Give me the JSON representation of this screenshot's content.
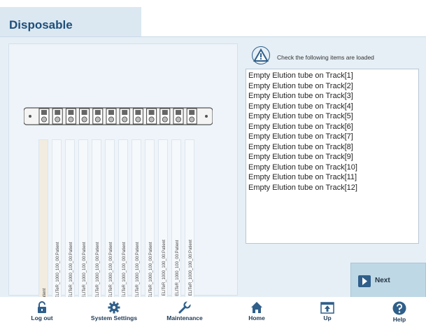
{
  "header": {
    "title": "Disposable",
    "top_right_text": ""
  },
  "instruction": {
    "text": "Check the following items are loaded"
  },
  "items": [
    "Empty Elution tube on Track[1]",
    "Empty Elution tube on Track[2]",
    "Empty Elution tube on Track[3]",
    "Empty Elution tube on Track[4]",
    "Empty Elution tube on Track[5]",
    "Empty Elution tube on Track[6]",
    "Empty Elution tube on Track[7]",
    "Empty Elution tube on Track[8]",
    "Empty Elution tube on Track[9]",
    "Empty Elution tube on Track[10]",
    "Empty Elution tube on Track[11]",
    "Empty Elution tube on Track[12]"
  ],
  "track_labels": [
    "EI 00_00:Patient",
    "EG 2:CMV ELITeR_1000_100_00:Patient",
    "EG 3:CMV ELITeR_1000_100_00:Patient",
    "EG 4:CMV ELITeR_1000_100_00:Patient",
    "EG 5:CMV ELITeR_1000_100_00:Patient",
    "EG 6:CMV ELITeR_1000_100_00:Patient",
    "EG 7:CMV ELITeR_1000_100_00:Patient",
    "EG 8:CMV ELITeR_1000_100_00:Patient",
    "EG 9:CMV ELITeR_1000_100_00:Patient",
    "EG 10:CMV ELITeR_1000_100_00:Patient",
    "EG 11:CMV ELITeR_1000_100_00:Patient",
    "EG 12:CMV ELITeR_1000_100_00:Patient"
  ],
  "next_button": {
    "label": "Next"
  },
  "footer": {
    "logout": "Log out",
    "system_settings": "System Settings",
    "maintenance": "Maintenance",
    "home": "Home",
    "up": "Up",
    "help": "Help"
  },
  "colors": {
    "accent": "#1f4f7a",
    "panel": "#e6eff6",
    "button": "#bfd8e5"
  }
}
